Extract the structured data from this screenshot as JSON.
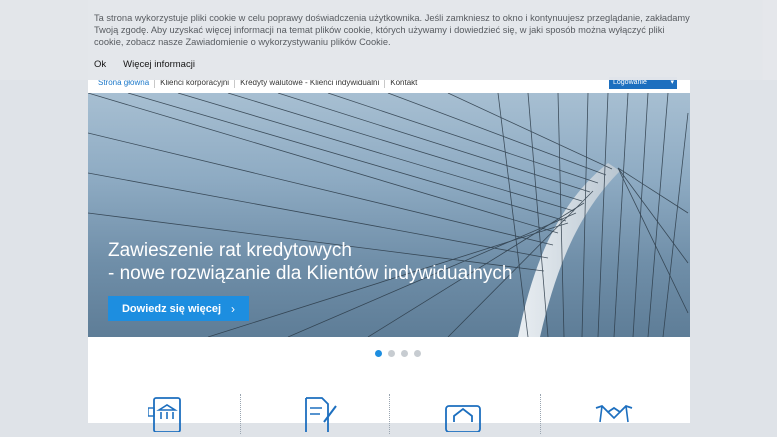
{
  "cookie_banner": {
    "text": "Ta strona wykorzystuje pliki cookie w celu poprawy doświadczenia użytkownika. Jeśli zamkniesz to okno i kontynuujesz przeglądanie, zakładamy Twoją zgodę. Aby uzyskać więcej informacji na temat plików cookie, których używamy i dowiedzieć się, w jaki sposób można wyłączyć pliki cookie, zobacz nasze Zawiadomienie o wykorzystywaniu plików Cookie.",
    "ok_label": "Ok",
    "more_label": "Więcej informacji"
  },
  "nav": {
    "items": [
      {
        "label": "Strona główna"
      },
      {
        "label": "Klienci korporacyjni"
      },
      {
        "label": "Kredyty walutowe - Klienci indywidualni"
      },
      {
        "label": "Kontakt"
      }
    ],
    "login_label": "Logowanie"
  },
  "hero": {
    "title_line1": "Zawieszenie rat kredytowych",
    "title_line2": "- nowe rozwiązanie dla Klientów indywidualnych",
    "button_label": "Dowiedz się więcej",
    "button_arrow": "›",
    "slides": 4,
    "active_slide": 1
  },
  "services": {
    "icons": [
      "online-bank-tablet-icon",
      "document-pen-icon",
      "home-icon",
      "handshake-icon"
    ]
  },
  "colors": {
    "accent": "#1d8ee0",
    "banner_bg": "#e4e7eb",
    "page_bg": "#dfe3e8"
  }
}
